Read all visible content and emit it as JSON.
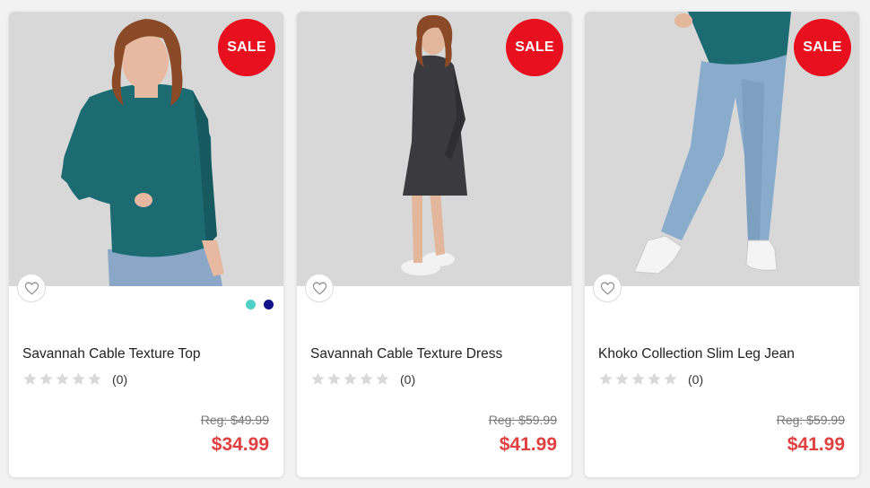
{
  "products": [
    {
      "badge": "SALE",
      "title": "Savannah Cable Texture Top",
      "rating_count": "(0)",
      "reg_price": "Reg: $49.99",
      "sale_price": "$34.99",
      "swatches": [
        "#4ecfc8",
        "#12128a"
      ]
    },
    {
      "badge": "SALE",
      "title": "Savannah Cable Texture Dress",
      "rating_count": "(0)",
      "reg_price": "Reg: $59.99",
      "sale_price": "$41.99"
    },
    {
      "badge": "SALE",
      "title": "Khoko Collection Slim Leg Jean",
      "rating_count": "(0)",
      "reg_price": "Reg: $59.99",
      "sale_price": "$41.99"
    }
  ],
  "colors": {
    "sale_badge": "#e8101f",
    "sale_price": "#e04040",
    "star_empty": "#d9d9d9"
  },
  "icons": {
    "wishlist": "heart-outline-icon",
    "rating": "star-icon"
  }
}
